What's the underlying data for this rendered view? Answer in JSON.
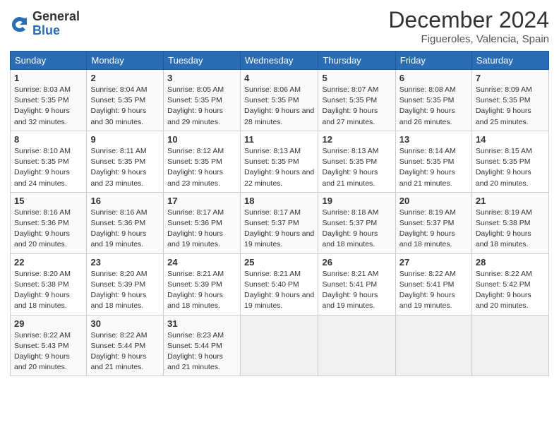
{
  "header": {
    "logo_general": "General",
    "logo_blue": "Blue",
    "title": "December 2024",
    "location": "Figueroles, Valencia, Spain"
  },
  "weekdays": [
    "Sunday",
    "Monday",
    "Tuesday",
    "Wednesday",
    "Thursday",
    "Friday",
    "Saturday"
  ],
  "weeks": [
    [
      {
        "day": 1,
        "sunrise": "8:03 AM",
        "sunset": "5:35 PM",
        "daylight": "9 hours and 32 minutes"
      },
      {
        "day": 2,
        "sunrise": "8:04 AM",
        "sunset": "5:35 PM",
        "daylight": "9 hours and 30 minutes"
      },
      {
        "day": 3,
        "sunrise": "8:05 AM",
        "sunset": "5:35 PM",
        "daylight": "9 hours and 29 minutes"
      },
      {
        "day": 4,
        "sunrise": "8:06 AM",
        "sunset": "5:35 PM",
        "daylight": "9 hours and 28 minutes"
      },
      {
        "day": 5,
        "sunrise": "8:07 AM",
        "sunset": "5:35 PM",
        "daylight": "9 hours and 27 minutes"
      },
      {
        "day": 6,
        "sunrise": "8:08 AM",
        "sunset": "5:35 PM",
        "daylight": "9 hours and 26 minutes"
      },
      {
        "day": 7,
        "sunrise": "8:09 AM",
        "sunset": "5:35 PM",
        "daylight": "9 hours and 25 minutes"
      }
    ],
    [
      {
        "day": 8,
        "sunrise": "8:10 AM",
        "sunset": "5:35 PM",
        "daylight": "9 hours and 24 minutes"
      },
      {
        "day": 9,
        "sunrise": "8:11 AM",
        "sunset": "5:35 PM",
        "daylight": "9 hours and 23 minutes"
      },
      {
        "day": 10,
        "sunrise": "8:12 AM",
        "sunset": "5:35 PM",
        "daylight": "9 hours and 23 minutes"
      },
      {
        "day": 11,
        "sunrise": "8:13 AM",
        "sunset": "5:35 PM",
        "daylight": "9 hours and 22 minutes"
      },
      {
        "day": 12,
        "sunrise": "8:13 AM",
        "sunset": "5:35 PM",
        "daylight": "9 hours and 21 minutes"
      },
      {
        "day": 13,
        "sunrise": "8:14 AM",
        "sunset": "5:35 PM",
        "daylight": "9 hours and 21 minutes"
      },
      {
        "day": 14,
        "sunrise": "8:15 AM",
        "sunset": "5:35 PM",
        "daylight": "9 hours and 20 minutes"
      }
    ],
    [
      {
        "day": 15,
        "sunrise": "8:16 AM",
        "sunset": "5:36 PM",
        "daylight": "9 hours and 20 minutes"
      },
      {
        "day": 16,
        "sunrise": "8:16 AM",
        "sunset": "5:36 PM",
        "daylight": "9 hours and 19 minutes"
      },
      {
        "day": 17,
        "sunrise": "8:17 AM",
        "sunset": "5:36 PM",
        "daylight": "9 hours and 19 minutes"
      },
      {
        "day": 18,
        "sunrise": "8:17 AM",
        "sunset": "5:37 PM",
        "daylight": "9 hours and 19 minutes"
      },
      {
        "day": 19,
        "sunrise": "8:18 AM",
        "sunset": "5:37 PM",
        "daylight": "9 hours and 18 minutes"
      },
      {
        "day": 20,
        "sunrise": "8:19 AM",
        "sunset": "5:37 PM",
        "daylight": "9 hours and 18 minutes"
      },
      {
        "day": 21,
        "sunrise": "8:19 AM",
        "sunset": "5:38 PM",
        "daylight": "9 hours and 18 minutes"
      }
    ],
    [
      {
        "day": 22,
        "sunrise": "8:20 AM",
        "sunset": "5:38 PM",
        "daylight": "9 hours and 18 minutes"
      },
      {
        "day": 23,
        "sunrise": "8:20 AM",
        "sunset": "5:39 PM",
        "daylight": "9 hours and 18 minutes"
      },
      {
        "day": 24,
        "sunrise": "8:21 AM",
        "sunset": "5:39 PM",
        "daylight": "9 hours and 18 minutes"
      },
      {
        "day": 25,
        "sunrise": "8:21 AM",
        "sunset": "5:40 PM",
        "daylight": "9 hours and 19 minutes"
      },
      {
        "day": 26,
        "sunrise": "8:21 AM",
        "sunset": "5:41 PM",
        "daylight": "9 hours and 19 minutes"
      },
      {
        "day": 27,
        "sunrise": "8:22 AM",
        "sunset": "5:41 PM",
        "daylight": "9 hours and 19 minutes"
      },
      {
        "day": 28,
        "sunrise": "8:22 AM",
        "sunset": "5:42 PM",
        "daylight": "9 hours and 20 minutes"
      }
    ],
    [
      {
        "day": 29,
        "sunrise": "8:22 AM",
        "sunset": "5:43 PM",
        "daylight": "9 hours and 20 minutes"
      },
      {
        "day": 30,
        "sunrise": "8:22 AM",
        "sunset": "5:44 PM",
        "daylight": "9 hours and 21 minutes"
      },
      {
        "day": 31,
        "sunrise": "8:23 AM",
        "sunset": "5:44 PM",
        "daylight": "9 hours and 21 minutes"
      },
      null,
      null,
      null,
      null
    ]
  ]
}
